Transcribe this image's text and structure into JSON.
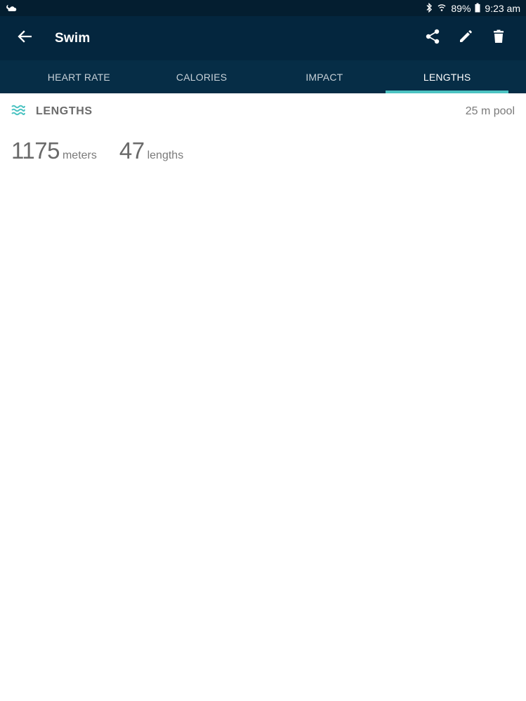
{
  "status_bar": {
    "weather_icon": "weather-cloud-moon-icon",
    "battery": "89%",
    "time": "9:23 am"
  },
  "app_bar": {
    "title": "Swim"
  },
  "tabs": [
    {
      "label": "HEART RATE",
      "active": false
    },
    {
      "label": "CALORIES",
      "active": false
    },
    {
      "label": "IMPACT",
      "active": false
    },
    {
      "label": "LENGTHS",
      "active": true
    }
  ],
  "section": {
    "title": "LENGTHS",
    "pool": "25 m pool"
  },
  "stats": {
    "distance_value": "1175",
    "distance_unit": "meters",
    "lengths_value": "47",
    "lengths_unit": "lengths"
  },
  "colors": {
    "status_bar": "#041e30",
    "app_bar": "#04263e",
    "tab_bar": "#062d46",
    "accent": "#4cc3c2"
  }
}
